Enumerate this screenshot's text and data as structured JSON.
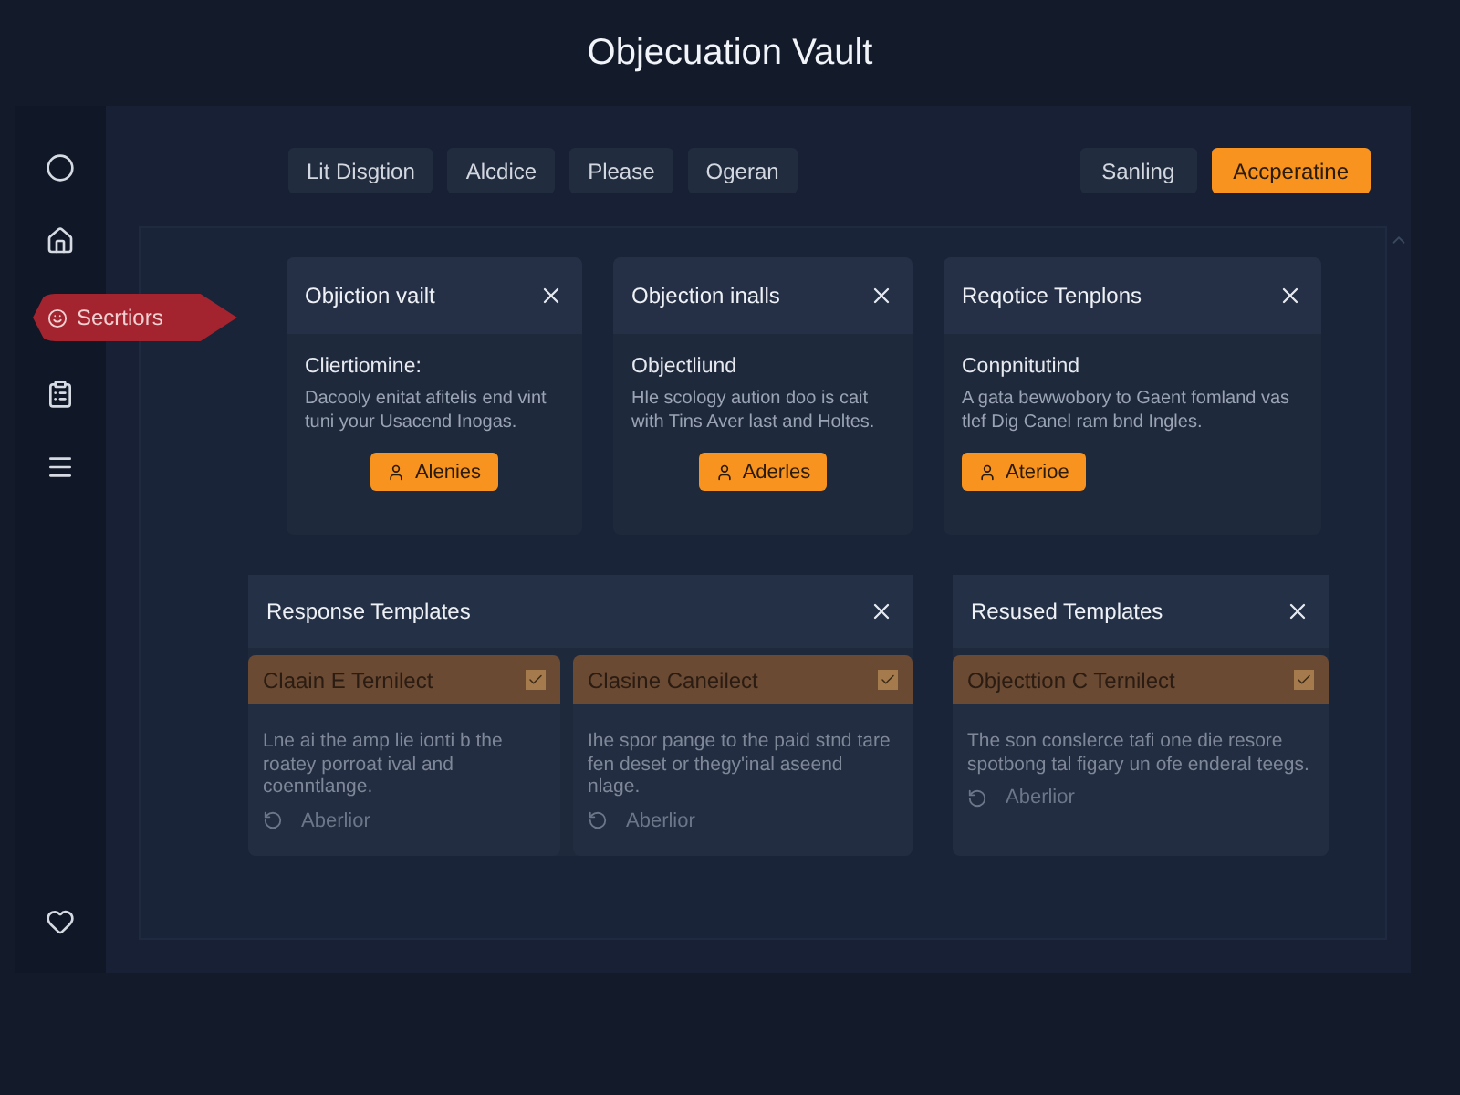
{
  "title": "Objecuation Vault",
  "sidebar": [
    {
      "kind": "circle"
    },
    {
      "kind": "house"
    },
    {
      "kind": "badge",
      "label": "Secrtiors"
    },
    {
      "kind": "clipboard"
    },
    {
      "kind": "menu"
    },
    {
      "kind": "heart"
    }
  ],
  "tabs": [
    "Lit Disgtion",
    "Alcdice",
    "Please",
    "Ogeran"
  ],
  "actions": [
    {
      "label": "Sanling",
      "primary": false
    },
    {
      "label": "Accperatine",
      "primary": true
    }
  ],
  "cards": [
    {
      "title": "Objiction vailt",
      "heading": "Cliertiomine:",
      "text": "Dacooly enitat afitelis end vint tuni your Usacend Inogas.",
      "button": "Alenies"
    },
    {
      "title": "Objection inalls",
      "heading": "Objectliund",
      "text": "Hle scology aution doo is cait with Tins Aver last and Holtes.",
      "button": "Aderles"
    },
    {
      "title": "Reqotice Tenplons",
      "heading": "Conpnitutind",
      "text": "A gata bewwobory to Gaent fomland vas tlef Dig Canel ram bnd Ingles.",
      "button": "Aterioe"
    }
  ],
  "groups": [
    {
      "title": "Response Templates",
      "items": [
        {
          "title": "Claain E Ternilect",
          "text": "Lne ai the amp lie ionti b the roatey porroat ival and coenntlange.",
          "action": "Aberlior"
        },
        {
          "title": "Clasine Caneilect",
          "text": "Ihe spor pange to the paid stnd tare fen deset or thegy'inal aseend nlage.",
          "action": "Aberlior"
        }
      ]
    },
    {
      "title": "Resused Templates",
      "items": [
        {
          "title": "Objecttion C Ternilect",
          "text": "The son conslerce tafi one die resore spotbong tal figary un ofe enderal teegs.",
          "action": "Aberlior"
        }
      ]
    }
  ]
}
